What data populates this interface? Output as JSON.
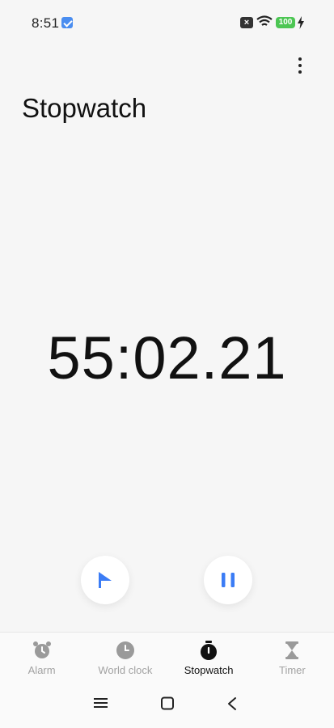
{
  "status_bar": {
    "time": "8:51",
    "battery": "100",
    "icons": [
      "app-notification-icon",
      "sim-x-icon",
      "wifi-icon",
      "battery-icon",
      "charging-bolt-icon"
    ]
  },
  "header": {
    "title": "Stopwatch",
    "menu_icon": "more-vertical-icon"
  },
  "stopwatch": {
    "elapsed": "55:02.21"
  },
  "controls": {
    "lap_icon": "flag-icon",
    "pause_icon": "pause-icon",
    "accent_color": "#3b7cf5"
  },
  "bottom_nav": {
    "items": [
      {
        "label": "Alarm",
        "icon": "alarm-clock-icon",
        "active": false
      },
      {
        "label": "World clock",
        "icon": "clock-icon",
        "active": false
      },
      {
        "label": "Stopwatch",
        "icon": "stopwatch-icon",
        "active": true
      },
      {
        "label": "Timer",
        "icon": "hourglass-icon",
        "active": false
      }
    ]
  },
  "system_nav": {
    "icons": [
      "menu-icon",
      "home-icon",
      "back-icon"
    ]
  }
}
